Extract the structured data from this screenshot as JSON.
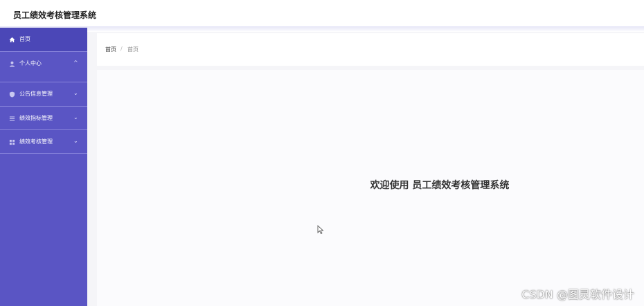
{
  "header": {
    "title": "员工绩效考核管理系统"
  },
  "sidebar": {
    "items": [
      {
        "label": "首页",
        "icon": "home-icon",
        "expandable": false
      },
      {
        "label": "个人中心",
        "icon": "user-icon",
        "expandable": true,
        "expanded": true
      },
      {
        "label": "公告信息管理",
        "icon": "shield-icon",
        "expandable": true
      },
      {
        "label": "绩效指标管理",
        "icon": "list-icon",
        "expandable": true
      },
      {
        "label": "绩效考核管理",
        "icon": "grid-icon",
        "expandable": true
      }
    ]
  },
  "breadcrumb": {
    "home": "首页",
    "separator": "/",
    "current": "首页"
  },
  "main": {
    "welcome": "欢迎使用 员工绩效考核管理系统"
  },
  "watermark": "CSDN @图灵软件设计",
  "colors": {
    "sidebar": "#5a55c4",
    "sidebar_active": "#4b47b7",
    "content_bg": "#f5f5f8"
  }
}
